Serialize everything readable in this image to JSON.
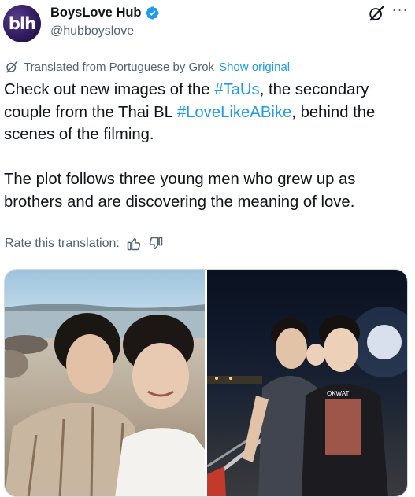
{
  "header": {
    "avatar_text": "blh",
    "display_name": "BoysLove Hub",
    "handle": "@hubboyslove",
    "verified_icon": "verified-badge-icon",
    "grok_icon": "grok-icon",
    "more_label": "···"
  },
  "translation": {
    "translated_text": "Translated from Portuguese by Grok",
    "show_original": "Show original"
  },
  "post": {
    "p1_part1": "Check out new images of the ",
    "p1_hashtag1": "#TaUs",
    "p1_part2": ", the secondary couple from the Thai BL ",
    "p1_hashtag2": "#LoveLikeABike",
    "p1_part3": ", behind the scenes of the filming.",
    "p2": "The plot follows three young men who grew up as brothers and are discovering the meaning of love."
  },
  "rate": {
    "label": "Rate this translation:",
    "thumbs_up_icon": "thumbs-up-icon",
    "thumbs_down_icon": "thumbs-down-icon"
  },
  "media": {
    "photos": [
      {
        "description_icon": "photo-beach-two-men"
      },
      {
        "description_icon": "photo-night-two-men"
      }
    ],
    "shirt_text": "OKWATI"
  },
  "colors": {
    "accent": "#1d9bf0",
    "secondary_text": "#536471",
    "primary_text": "#0f1419"
  }
}
